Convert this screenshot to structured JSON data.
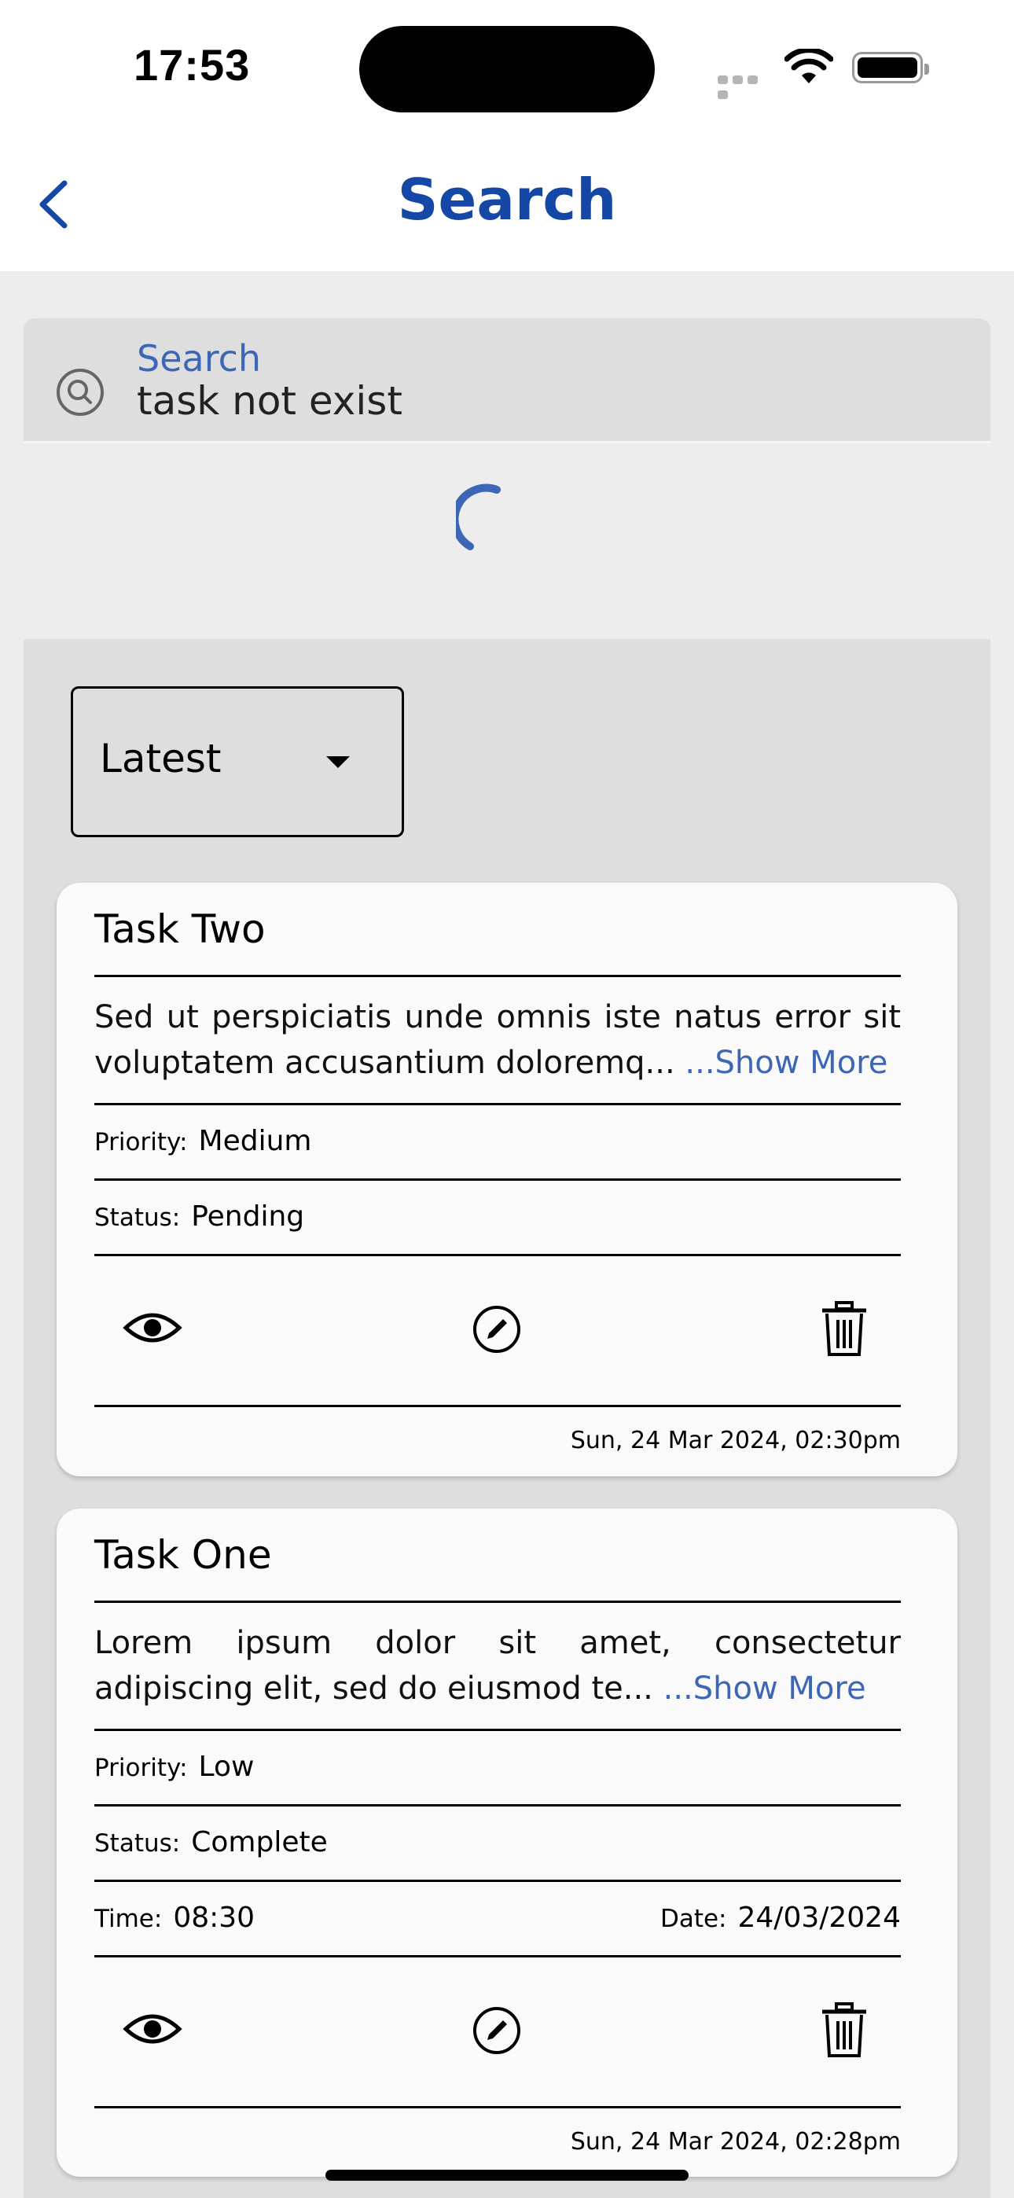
{
  "status_bar": {
    "time": "17:53"
  },
  "nav": {
    "title": "Search"
  },
  "search": {
    "label": "Search",
    "value": "task not exist"
  },
  "sort": {
    "selected": "Latest"
  },
  "tasks": [
    {
      "title": "Task Two",
      "description": "Sed ut perspiciatis unde omnis iste natus error sit voluptatem accusantium doloremq...",
      "show_more": " ...Show More",
      "priority_label": "Priority:",
      "priority": "Medium",
      "status_label": "Status:",
      "status": "Pending",
      "timestamp": "Sun, 24 Mar 2024, 02:30pm"
    },
    {
      "title": "Task One",
      "description": "Lorem ipsum dolor sit amet, consectetur adipiscing elit, sed do eiusmod te...",
      "show_more": " ...Show More",
      "priority_label": "Priority:",
      "priority": "Low",
      "status_label": "Status:",
      "status": "Complete",
      "time_label": "Time:",
      "time": "08:30",
      "date_label": "Date:",
      "date": "24/03/2024",
      "timestamp": "Sun, 24 Mar 2024, 02:28pm"
    }
  ],
  "colors": {
    "accent": "#1548a6",
    "link": "#3d66b6",
    "background": "#ededed",
    "panel": "#dedede"
  }
}
